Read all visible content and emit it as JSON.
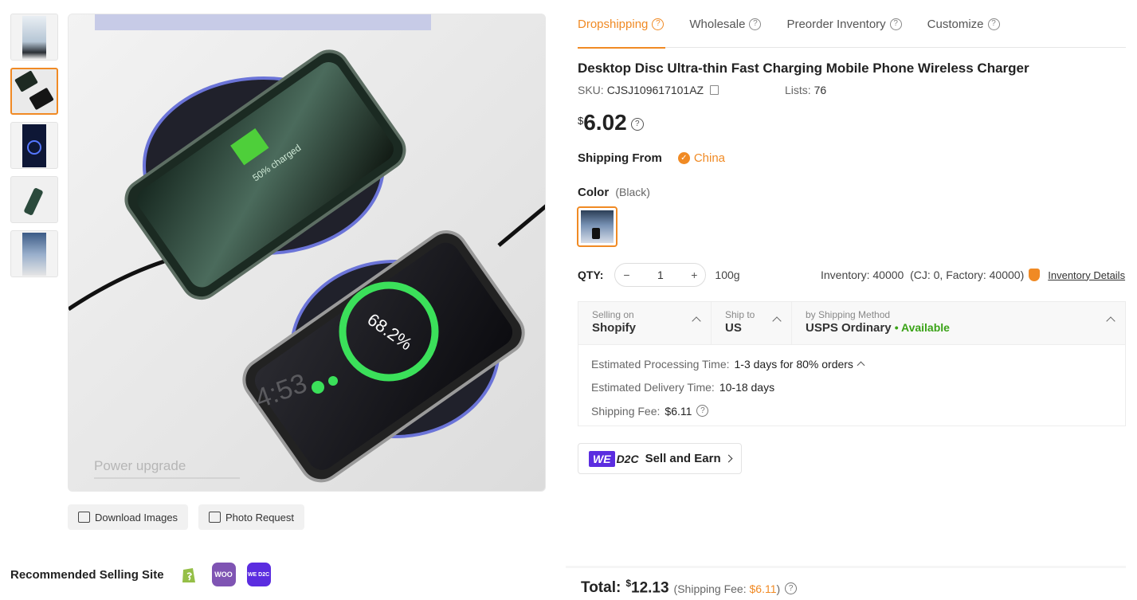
{
  "tabs": [
    {
      "label": "Dropshipping",
      "active": true
    },
    {
      "label": "Wholesale",
      "active": false
    },
    {
      "label": "Preorder Inventory",
      "active": false
    },
    {
      "label": "Customize",
      "active": false
    }
  ],
  "product": {
    "title": "Desktop Disc Ultra-thin Fast Charging Mobile Phone Wireless Charger",
    "sku_label": "SKU:",
    "sku": "CJSJ109617101AZ",
    "lists_label": "Lists:",
    "lists": "76",
    "currency": "$",
    "price": "6.02"
  },
  "shipping_from": {
    "label": "Shipping From",
    "value": "China"
  },
  "color": {
    "label": "Color",
    "selected": "(Black)"
  },
  "qty": {
    "label": "QTY:",
    "value": "1",
    "weight": "100g",
    "inventory": "Inventory: 40000  (CJ: 0, Factory: 40000)",
    "details_link": "Inventory Details"
  },
  "shipping": {
    "selling_on_label": "Selling on",
    "selling_on": "Shopify",
    "ship_to_label": "Ship to",
    "ship_to": "US",
    "method_label": "by Shipping Method",
    "method": "USPS Ordinary",
    "availability": "• Available",
    "processing_label": "Estimated Processing Time:",
    "processing": "1-3 days for 80% orders",
    "delivery_label": "Estimated Delivery Time:",
    "delivery": "10-18 days",
    "fee_label": "Shipping Fee:",
    "fee": "$6.11"
  },
  "d2c": {
    "we": "WE",
    "d2c": "D2C",
    "label": "Sell and Earn"
  },
  "image_buttons": {
    "download": "Download Images",
    "photo": "Photo Request"
  },
  "recommended": {
    "title": "Recommended Selling Site",
    "sites": [
      "shopify",
      "woo",
      "we-d2c"
    ],
    "woo_text": "WOO",
    "wed2c_text": "WE D2C"
  },
  "image_overlay": {
    "watermark": "Power upgrade",
    "pct_top": "50% charged",
    "pct_bottom": "68.2%",
    "time": "4:53"
  },
  "total": {
    "label": "Total:",
    "currency": "$",
    "value": "12.13",
    "fee_prefix": "(Shipping Fee: ",
    "fee": "$6.11",
    "fee_suffix": ")"
  },
  "colors": {
    "accent": "#f08a24",
    "available": "#3aa317",
    "brand_d2c": "#5b2de0"
  }
}
